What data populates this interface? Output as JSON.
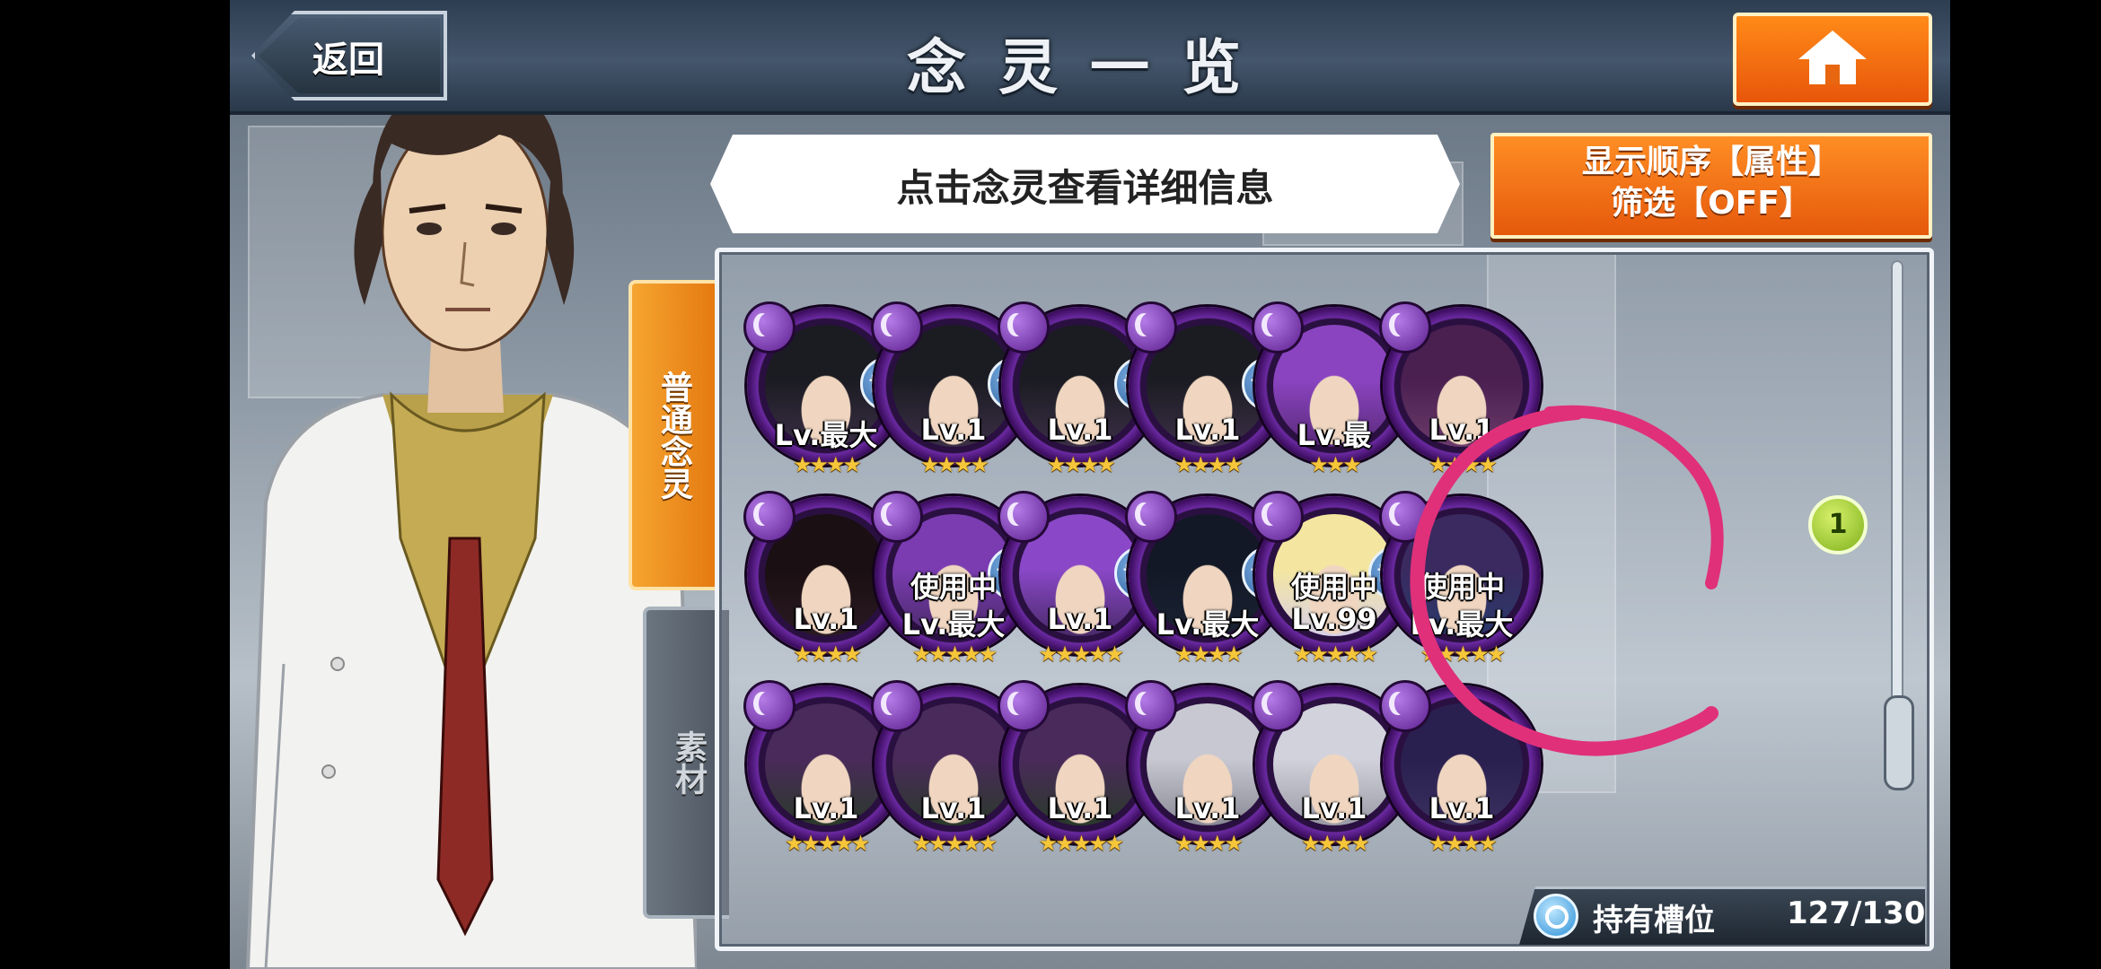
{
  "header": {
    "title": "念灵一览",
    "back_label": "返回"
  },
  "hint": "点击念灵查看详细信息",
  "sort": {
    "line1": "显示顺序【属性】",
    "line2": "筛选【OFF】"
  },
  "tabs": {
    "normal": "普通念灵",
    "material": "素材"
  },
  "cards": [
    {
      "lv": "Lv.最大",
      "stars": "★★★★",
      "coop": "协力",
      "inuse": "",
      "hue": "#3a2f45",
      "hair": "#1b1b22"
    },
    {
      "lv": "Lv.1",
      "stars": "★★★★",
      "coop": "协力",
      "inuse": "",
      "hue": "#3a2f45",
      "hair": "#1b1b22"
    },
    {
      "lv": "Lv.1",
      "stars": "★★★★",
      "coop": "协力",
      "inuse": "",
      "hue": "#3a2f45",
      "hair": "#1b1b22"
    },
    {
      "lv": "Lv.1",
      "stars": "★★★★",
      "coop": "协力",
      "inuse": "",
      "hue": "#3a2f45",
      "hair": "#1b1b22"
    },
    {
      "lv": "Lv.最",
      "stars": "★★★",
      "coop": "",
      "inuse": "",
      "hue": "#5a2a7a",
      "hair": "#8a44c0"
    },
    {
      "lv": "Lv.1",
      "stars": "★★★★",
      "coop": "",
      "inuse": "",
      "hue": "#6a3a6a",
      "hair": "#4a2050"
    },
    {
      "lv": "Lv.1",
      "stars": "★★★★",
      "coop": "",
      "inuse": "",
      "hue": "#2a1a22",
      "hair": "#1a0f12"
    },
    {
      "lv": "Lv.最大",
      "stars": "★★★★★",
      "coop": "协力",
      "inuse": "使用中",
      "hue": "#4a2a6a",
      "hair": "#7a3cb0"
    },
    {
      "lv": "Lv.1",
      "stars": "★★★★★",
      "coop": "协力",
      "inuse": "",
      "hue": "#4a2a6a",
      "hair": "#8a48c8"
    },
    {
      "lv": "Lv.最大",
      "stars": "★★★★",
      "coop": "协力",
      "inuse": "",
      "hue": "#1a2232",
      "hair": "#121826"
    },
    {
      "lv": "Lv.99",
      "stars": "★★★★★",
      "coop": "协力",
      "inuse": "使用中",
      "hue": "#d8d0e8",
      "hair": "#f4e6a0"
    },
    {
      "lv": "Lv.最大",
      "stars": "★★★★★",
      "coop": "",
      "inuse": "使用中",
      "hue": "#2a3a6a",
      "hair": "#3a2a60"
    },
    {
      "lv": "Lv.1",
      "stars": "★★★★★",
      "coop": "",
      "inuse": "",
      "hue": "#2a3a2a",
      "hair": "#4a2a5a"
    },
    {
      "lv": "Lv.1",
      "stars": "★★★★★",
      "coop": "",
      "inuse": "",
      "hue": "#2a3a2a",
      "hair": "#4a2a5a"
    },
    {
      "lv": "Lv.1",
      "stars": "★★★★★",
      "coop": "",
      "inuse": "",
      "hue": "#2a3a2a",
      "hair": "#4a2a5a"
    },
    {
      "lv": "Lv.1",
      "stars": "★★★★",
      "coop": "",
      "inuse": "",
      "hue": "#8a8a96",
      "hair": "#c8c8d2"
    },
    {
      "lv": "Lv.1",
      "stars": "★★★★",
      "coop": "",
      "inuse": "",
      "hue": "#9a9aa6",
      "hair": "#d2d2dc"
    },
    {
      "lv": "Lv.1",
      "stars": "★★★★",
      "coop": "",
      "inuse": "",
      "hue": "#3a3060",
      "hair": "#2a2050"
    }
  ],
  "new_badge": "1",
  "slots": {
    "label": "持有槽位",
    "count": "127/130"
  },
  "colors": {
    "orange": "#e8660f",
    "purple_ring": "#6b2aa2",
    "annotation": "#e0307a"
  }
}
